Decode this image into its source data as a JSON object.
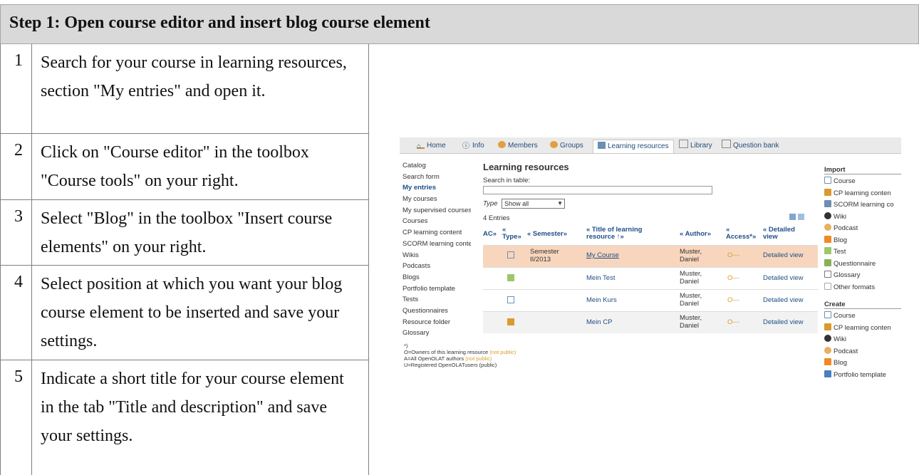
{
  "header": {
    "title": "Step 1: Open course editor and insert blog course element"
  },
  "steps": [
    {
      "num": "1",
      "text": "Search for your course in learning resources, section \"My entries\" and open it."
    },
    {
      "num": "2",
      "text": "Click on \"Course editor\" in the toolbox \"Course tools\" on your right."
    },
    {
      "num": "3",
      "text": "Select \"Blog\" in the toolbox \"Insert course elements\" on your right."
    },
    {
      "num": "4",
      "text": "Select position at which you want your blog course element to be inserted and save your settings."
    },
    {
      "num": "5",
      "text": "Indicate a short title for your course element in the tab \"Title and description\" and save your settings."
    }
  ],
  "screenshot": {
    "tabs": [
      "Home",
      "Info",
      "Members",
      "Groups",
      "Learning resources",
      "Library",
      "Question bank"
    ],
    "nav": [
      "Catalog",
      "Search form",
      "My entries",
      "My courses",
      "My supervised courses",
      "Courses",
      "CP learning content",
      "SCORM learning content",
      "Wikis",
      "Podcasts",
      "Blogs",
      "Portfolio template",
      "Tests",
      "Questionnaires",
      "Resource folder",
      "Glossary"
    ],
    "title": "Learning resources",
    "search_label": "Search in table:",
    "type_label": "Type",
    "type_value": "Show all",
    "entries": "4 Entries",
    "columns": [
      "AC»",
      "« Type»",
      "« Semester»",
      "« Title of learning resource ↑»",
      "« Author»",
      "« Access*»",
      "« Detailed view"
    ],
    "rows": [
      {
        "semester": "Semester II/2013",
        "title": "My Course",
        "author": "Muster, Daniel",
        "access": "O---",
        "view": "Detailed view"
      },
      {
        "semester": "",
        "title": "Mein Test",
        "author": "Muster, Daniel",
        "access": "O---",
        "view": "Detailed view"
      },
      {
        "semester": "",
        "title": "Mein Kurs",
        "author": "Muster, Daniel",
        "access": "O---",
        "view": "Detailed view"
      },
      {
        "semester": "",
        "title": "Mein CP",
        "author": "Muster, Daniel",
        "access": "O---",
        "view": "Detailed view"
      }
    ],
    "import_head": "Import",
    "import_items": [
      "Course",
      "CP learning conten",
      "SCORM learning co",
      "Wiki",
      "Podcast",
      "Blog",
      "Test",
      "Questionnaire",
      "Glossary",
      "Other formats"
    ],
    "create_head": "Create",
    "create_items": [
      "Course",
      "CP learning conten",
      "Wiki",
      "Podcast",
      "Blog",
      "Portfolio template"
    ],
    "footnote": {
      "star": "*)",
      "l1": "O=Owners of this learning resource",
      "l1b": "(not public)",
      "l2": "A=All OpenOLAT authors",
      "l2b": "(not public)",
      "l3": "U=Registered OpenOLATusers (public)"
    }
  }
}
